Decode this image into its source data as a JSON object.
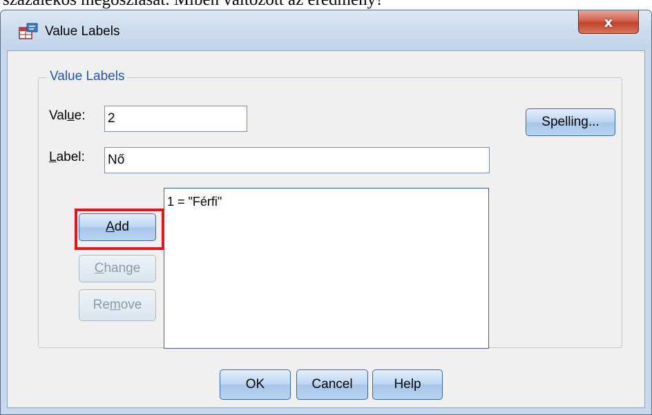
{
  "background_text": "százalékos megoszlását. Miben változott az eredmény?",
  "window": {
    "title": "Value Labels",
    "close_glyph": "x"
  },
  "group": {
    "legend": "Value Labels"
  },
  "value_field": {
    "label_pre": "Val",
    "label_accel": "u",
    "label_post": "e:",
    "value": "2"
  },
  "label_field": {
    "label_accel": "L",
    "label_post": "abel:",
    "value": "Nő"
  },
  "list": {
    "items": [
      "1 = \"Férfi\""
    ]
  },
  "buttons": {
    "spelling": "Spelling...",
    "add_accel": "A",
    "add_post": "dd",
    "change_accel": "C",
    "change_post": "hange",
    "remove_pre": "Re",
    "remove_accel": "m",
    "remove_post": "ove",
    "ok": "OK",
    "cancel": "Cancel",
    "help": "Help"
  },
  "colors": {
    "highlight": "#e3161e",
    "legend_text": "#2553b0",
    "close_button": "#c7432e"
  }
}
